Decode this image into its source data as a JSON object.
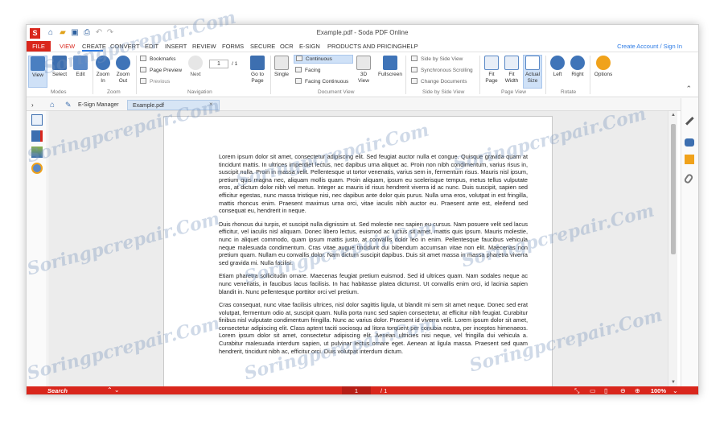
{
  "window": {
    "title": "Example.pdf - Soda PDF Online"
  },
  "app": {
    "logo_letter": "S"
  },
  "menu": {
    "file": "FILE",
    "items": [
      "VIEW",
      "CREATE",
      "CONVERT",
      "EDIT",
      "INSERT",
      "REVIEW",
      "FORMS",
      "SECURE",
      "OCR",
      "E-SIGN",
      "PRODUCTS AND PRICING",
      "HELP"
    ],
    "account": "Create Account / Sign In"
  },
  "ribbon": {
    "modes": {
      "view": "View",
      "select": "Select",
      "edit": "Edit",
      "group": "Modes"
    },
    "zoom": {
      "zoom_in_1": "Zoom",
      "zoom_in_2": "In",
      "zoom_out_1": "Zoom",
      "zoom_out_2": "Out",
      "group": "Zoom"
    },
    "navigation": {
      "bookmarks": "Bookmarks",
      "page_preview": "Page Preview",
      "previous": "Previous",
      "next": "Next",
      "page_value": "1",
      "page_total": "/ 1",
      "goto_1": "Go to",
      "goto_2": "Page",
      "group": "Navigation"
    },
    "document_view": {
      "single": "Single",
      "continuous": "Continuous",
      "facing": "Facing",
      "facing_continuous": "Facing Continuous",
      "view3d_1": "3D",
      "view3d_2": "View",
      "fullscreen": "Fullscreen",
      "group": "Document View"
    },
    "side_by_side": {
      "side_by_side_view": "Side by Side View",
      "sync_scrolling": "Synchronous Scrolling",
      "change_documents": "Change Documents",
      "group": "Side by Side View"
    },
    "page_view": {
      "fit_page_1": "Fit",
      "fit_page_2": "Page",
      "fit_width_1": "Fit",
      "fit_width_2": "Width",
      "actual_1": "Actual",
      "actual_2": "Size",
      "group": "Page View"
    },
    "rotate": {
      "left": "Left",
      "right": "Right",
      "group": "Rotate"
    },
    "options": "Options"
  },
  "tabs": {
    "esign": "E-Sign Manager",
    "doc": "Example.pdf",
    "close": "×"
  },
  "document": {
    "paragraphs": [
      "Lorem ipsum dolor sit amet, consectetur adipiscing elit. Sed feugiat auctor nulla et congue. Quisque gravida quam at tincidunt mattis. In ultrices imperdiet lectus, nec dapibus urna aliquet ac. Proin non nibh condimentum, varius risus in, suscipit nulla. Proin in massa velit. Pellentesque ut tortor venenatis, varius sem in, fermentum risus. Mauris nisl ipsum, pretium quis magna nec, aliquam mollis quam. Proin aliquam, ipsum eu scelerisque tempus, metus tellus vulputate eros, at dictum dolor nibh vel metus. Integer ac mauris id risus hendrerit viverra id ac nunc. Duis suscipit, sapien sed efficitur egestas, nunc massa tristique nisi, nec dapibus ante dolor quis purus. Nulla urna eros, volutpat in est fringilla, mattis rhoncus enim. Praesent maximus urna orci, vitae iaculis nibh auctor eu. Praesent ante est, eleifend sed consequat eu, hendrerit in neque.",
      "Duis rhoncus dui turpis, et suscipit nulla dignissim ut. Sed molestie nec sapien eu cursus. Nam posuere velit sed lacus efficitur, vel iaculis nisl aliquam. Donec libero lectus, euismod ac luctus sit amet, mattis quis ipsum. Mauris molestie, nunc in aliquet commodo, quam ipsum mattis justo, at convallis dolor leo in enim. Pellentesque faucibus vehicula neque malesuada condimentum. Cras vitae augue tincidunt dui bibendum accumsan vitae non elit. Maecenas non pretium quam. Nullam eu convallis dolor. Nam dictum suscipit dapibus. Duis sit amet massa in massa pharetra viverra sed gravida mi. Nulla facilisi.",
      "Etiam pharetra sollicitudin ornare. Maecenas feugiat pretium euismod. Sed id ultrices quam. Nam sodales neque ac nunc venenatis, in faucibus lacus facilisis. In hac habitasse platea dictumst. Ut convallis enim orci, id lacinia sapien blandit in. Nunc pellentesque porttitor orci vel pretium.",
      "Cras consequat, nunc vitae facilisis ultrices, nisl dolor sagittis ligula, ut blandit mi sem sit amet neque. Donec sed erat volutpat, fermentum odio at, suscipit quam. Nulla porta nunc sed sapien consectetur, at efficitur nibh feugiat. Curabitur finibus nisl vulputate condimentum fringilla. Nunc ac varius dolor. Praesent id viverra velit. Lorem ipsum dolor sit amet, consectetur adipiscing elit. Class aptent taciti sociosqu ad litora torquent per conubia nostra, per inceptos himenaeos. Lorem ipsum dolor sit amet, consectetur adipiscing elit. Aenean ultricies nisi neque, vel fringilla dui vehicula a. Curabitur malesuada interdum sapien, ut pulvinar lectus ornare eget. Aenean at ligula massa. Praesent sed quam hendrerit, tincidunt nibh ac, efficitur orci. Duis volutpat interdum dictum."
    ]
  },
  "status": {
    "search": "Search",
    "page": "1",
    "total": "/ 1",
    "zoom": "100%"
  },
  "watermark": "Soringpcrepair.Com",
  "colors": {
    "brand_red": "#d9261c",
    "accent_blue": "#2c7be5",
    "active_button": "#cfe1f7"
  }
}
